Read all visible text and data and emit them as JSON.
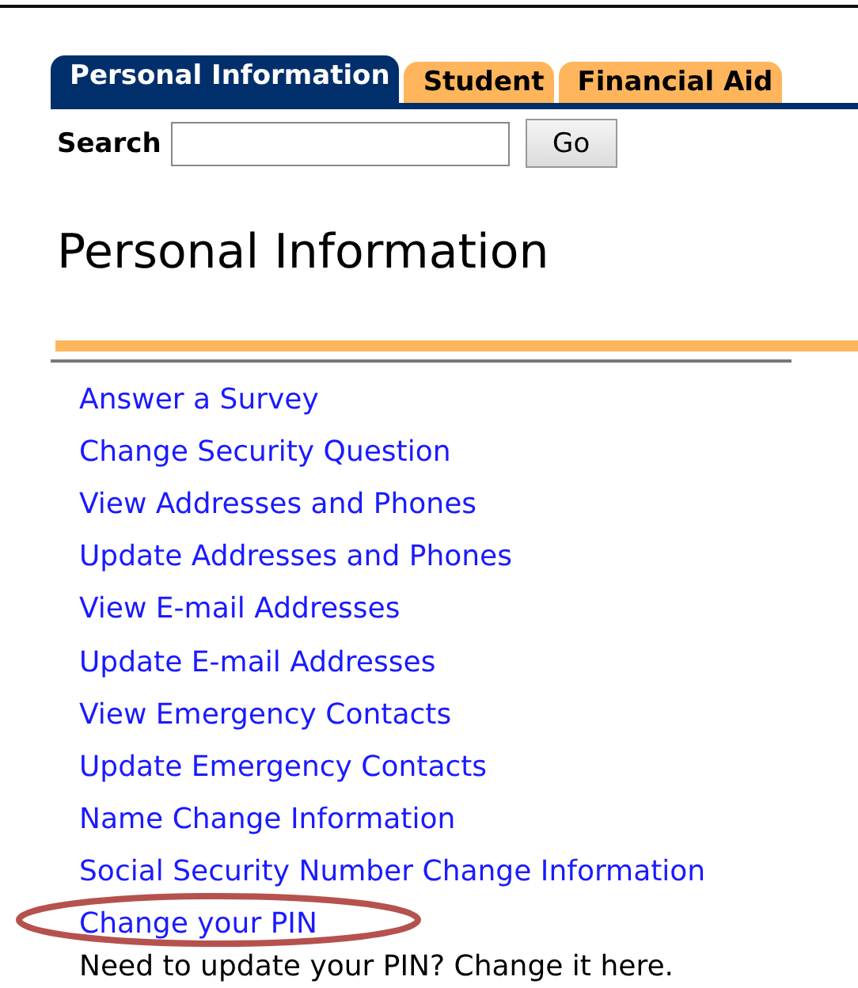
{
  "tabs": [
    {
      "label": "Personal Information",
      "selected": true
    },
    {
      "label": "Student",
      "selected": false
    },
    {
      "label": "Financial Aid",
      "selected": false
    }
  ],
  "search": {
    "label": "Search",
    "button": "Go"
  },
  "heading": "Personal Information",
  "links": [
    {
      "label": "Answer a Survey",
      "circled": false
    },
    {
      "label": "Change Security Question",
      "circled": false
    },
    {
      "label": "View Addresses and Phones",
      "circled": false
    },
    {
      "label": "Update Addresses and Phones",
      "circled": false
    },
    {
      "label": "View E-mail Addresses",
      "circled": false
    },
    {
      "label": "Update E-mail Addresses",
      "circled": false
    },
    {
      "label": "View Emergency Contacts",
      "circled": false
    },
    {
      "label": "Update Emergency Contacts",
      "circled": false
    },
    {
      "label": "Name Change Information",
      "circled": false
    },
    {
      "label": "Social Security Number Change Information",
      "circled": false
    },
    {
      "label": "Change your PIN",
      "circled": true,
      "description": "Need to update your PIN? Change it here."
    }
  ]
}
